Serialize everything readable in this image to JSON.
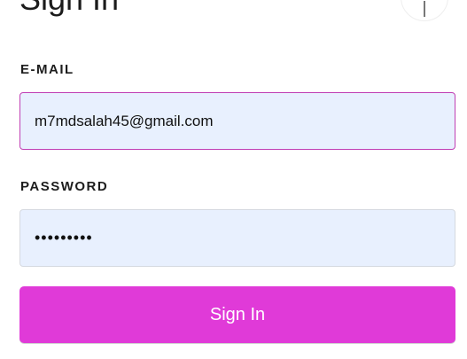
{
  "header": {
    "title": "Sign In",
    "close_icon": "close-icon"
  },
  "form": {
    "email": {
      "label": "E-MAIL",
      "value": "m7mdsalah45@gmail.com",
      "type": "email"
    },
    "password": {
      "label": "PASSWORD",
      "value": "•••••••••",
      "type": "password"
    },
    "submit_label": "Sign In"
  },
  "colors": {
    "accent": "#e03ad8",
    "input_background": "#e8f0fe",
    "focus_border": "#c03fb4",
    "text": "#1b1b1b"
  }
}
